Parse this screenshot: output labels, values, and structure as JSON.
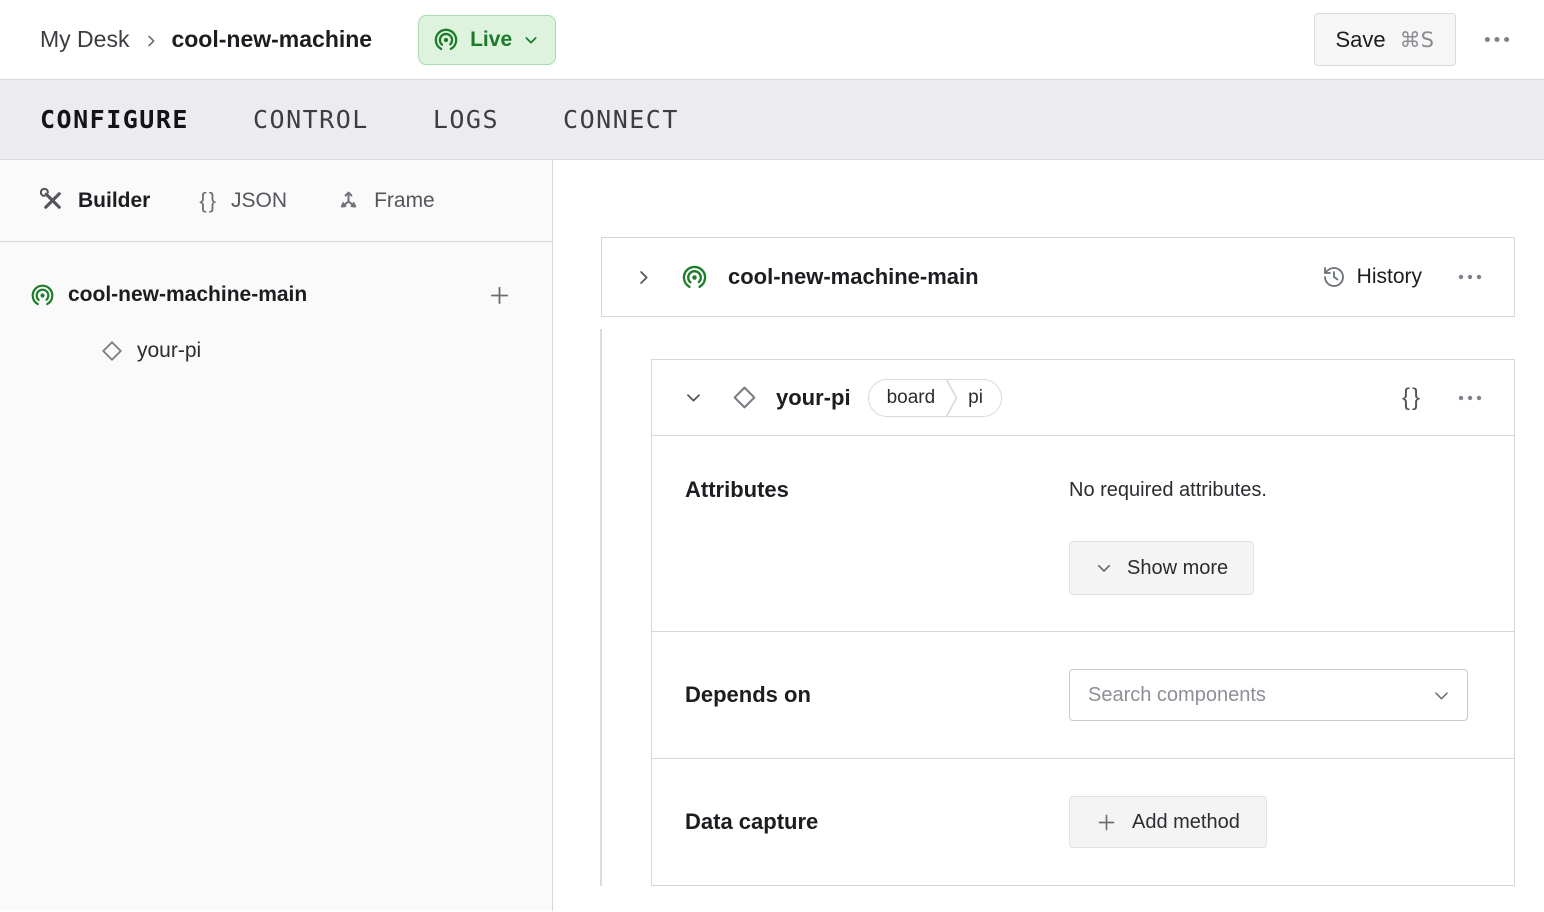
{
  "colors": {
    "accent_green": "#1e7d2b",
    "live_badge_bg": "#ddf3dd",
    "live_badge_border": "#abdcad",
    "live_badge_text": "#1d7a29"
  },
  "icons": {
    "live_status": "broadcast-icon",
    "builder": "crossed-tools-icon",
    "json": "{}",
    "frame": "axes-icon",
    "machine_part": "broadcast-icon",
    "component": "diamond-icon",
    "history": "clock-history-icon",
    "overflow_menu": "ellipsis-icon",
    "add": "plus-icon"
  },
  "header": {
    "breadcrumb": {
      "parent": "My Desk",
      "current": "cool-new-machine"
    },
    "live_status": "Live",
    "save_label": "Save",
    "save_shortcut": "⌘S"
  },
  "tabs": {
    "configure": "CONFIGURE",
    "control": "CONTROL",
    "logs": "LOGS",
    "connect": "CONNECT"
  },
  "sidebar": {
    "builder_label": "Builder",
    "json_label": "JSON",
    "json_glyph": "{}",
    "frame_label": "Frame",
    "tree": {
      "part": "cool-new-machine-main",
      "component": "your-pi"
    }
  },
  "main": {
    "part_card": {
      "title": "cool-new-machine-main",
      "history_label": "History"
    },
    "component_card": {
      "title": "your-pi",
      "type": "board",
      "model": "pi",
      "braces_glyph": "{}",
      "attributes": {
        "label": "Attributes",
        "empty_text": "No required attributes.",
        "show_more": "Show more"
      },
      "depends_on": {
        "label": "Depends on",
        "placeholder": "Search components"
      },
      "data_capture": {
        "label": "Data capture",
        "add_method": "Add method"
      }
    }
  }
}
